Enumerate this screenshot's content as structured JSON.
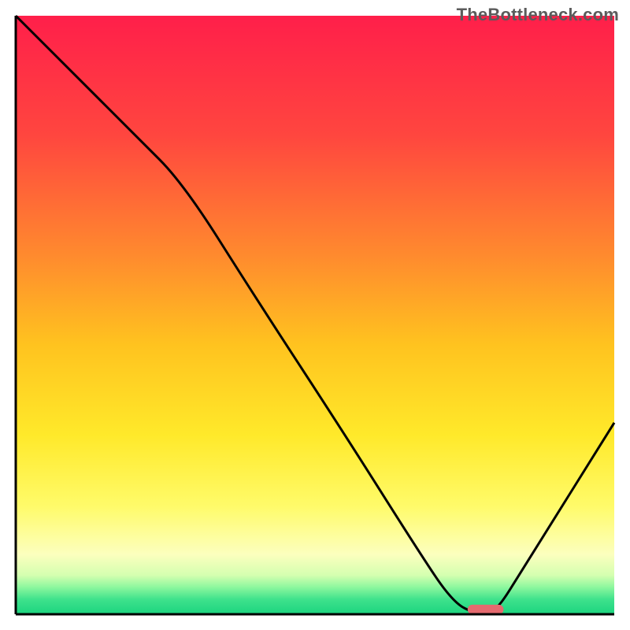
{
  "watermark": "TheBottleneck.com",
  "chart_data": {
    "type": "line",
    "title": "",
    "xlabel": "",
    "ylabel": "",
    "xlim": [
      0,
      100
    ],
    "ylim": [
      0,
      100
    ],
    "axes": {
      "ticks_visible": false,
      "grid": false,
      "border_left": true,
      "border_bottom": true,
      "border_top": false,
      "border_right": false
    },
    "background_gradient": {
      "direction": "vertical",
      "stops": [
        {
          "pos": 0.0,
          "color": "#ff1f4a"
        },
        {
          "pos": 0.2,
          "color": "#ff463f"
        },
        {
          "pos": 0.4,
          "color": "#ff8a2e"
        },
        {
          "pos": 0.55,
          "color": "#ffc31f"
        },
        {
          "pos": 0.7,
          "color": "#ffe92a"
        },
        {
          "pos": 0.82,
          "color": "#fffb6a"
        },
        {
          "pos": 0.9,
          "color": "#fcffbe"
        },
        {
          "pos": 0.935,
          "color": "#d4ffb0"
        },
        {
          "pos": 0.955,
          "color": "#8cf79e"
        },
        {
          "pos": 0.975,
          "color": "#3fe28c"
        },
        {
          "pos": 1.0,
          "color": "#1bd47f"
        }
      ]
    },
    "series": [
      {
        "name": "bottleneck-curve",
        "stroke": "#000000",
        "stroke_width": 2,
        "x": [
          0,
          10,
          20,
          28,
          40,
          55,
          67,
          73,
          77,
          80,
          85,
          90,
          95,
          100
        ],
        "y": [
          100,
          90,
          80,
          72,
          53,
          30,
          11,
          2,
          0,
          0,
          8,
          16,
          24,
          32
        ]
      }
    ],
    "marker": {
      "name": "sweet-spot",
      "shape": "rounded-bar",
      "x_center": 78.5,
      "y_center": 0.8,
      "width": 6,
      "height": 1.6,
      "fill": "#e56a6f"
    }
  }
}
